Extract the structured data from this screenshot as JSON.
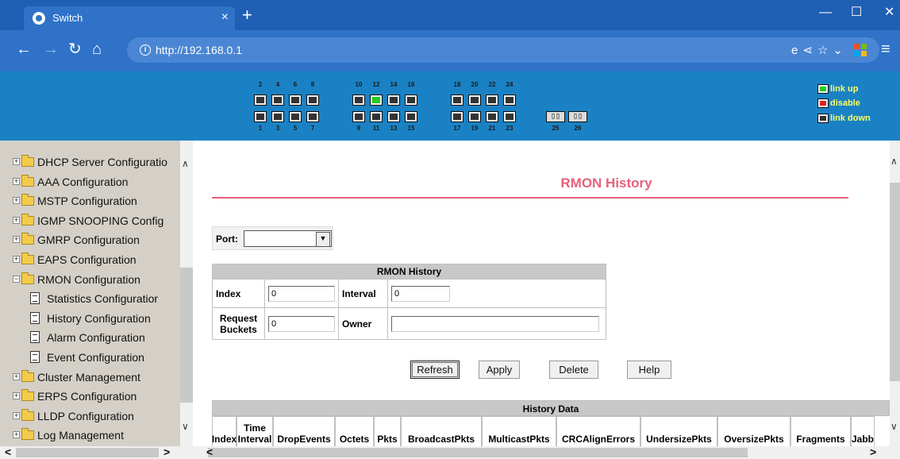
{
  "browser": {
    "tab_title": "Switch",
    "tab_close": "×",
    "new_tab": "+",
    "url": "http://192.168.0.1",
    "icons": [
      "browser-logo-icon",
      "back-icon",
      "forward-icon",
      "reload-icon",
      "home-icon",
      "info-icon",
      "ie-mode-icon",
      "share-icon",
      "star-icon",
      "chevron-down-icon",
      "apps-icon",
      "menu-icon",
      "minimize-icon",
      "maximize-icon",
      "close-icon"
    ]
  },
  "ports": {
    "top_numbers": [
      "2",
      "4",
      "6",
      "8",
      "10",
      "12",
      "14",
      "16",
      "18",
      "20",
      "22",
      "24"
    ],
    "bottom_numbers": [
      "1",
      "3",
      "5",
      "7",
      "9",
      "11",
      "13",
      "15",
      "17",
      "19",
      "21",
      "23"
    ],
    "fiber_numbers": [
      "25",
      "26"
    ],
    "link_up_port": "12",
    "legend": {
      "up": "link up",
      "disable": "disable",
      "down": "link down"
    },
    "colors": {
      "panel": "#1a82c4",
      "link_up": "#22cc22",
      "disable": "#dd2222",
      "legend_text": "#ffff66"
    }
  },
  "sidebar": {
    "items": [
      {
        "label": "DHCP Server Configuratio",
        "type": "folder",
        "expander": "+"
      },
      {
        "label": "AAA Configuration",
        "type": "folder",
        "expander": "+"
      },
      {
        "label": "MSTP Configuration",
        "type": "folder",
        "expander": "+"
      },
      {
        "label": "IGMP SNOOPING Config",
        "type": "folder",
        "expander": "+"
      },
      {
        "label": "GMRP Configuration",
        "type": "folder",
        "expander": "+"
      },
      {
        "label": "EAPS Configuration",
        "type": "folder",
        "expander": "+"
      },
      {
        "label": "RMON Configuration",
        "type": "folder-open",
        "expander": "−"
      },
      {
        "label": "Statistics Configuratior",
        "type": "doc"
      },
      {
        "label": "History Configuration",
        "type": "doc"
      },
      {
        "label": "Alarm Configuration",
        "type": "doc"
      },
      {
        "label": "Event Configuration",
        "type": "doc"
      },
      {
        "label": "Cluster Management",
        "type": "folder",
        "expander": "+"
      },
      {
        "label": "ERPS Configuration",
        "type": "folder",
        "expander": "+"
      },
      {
        "label": "LLDP Configuration",
        "type": "folder",
        "expander": "+"
      },
      {
        "label": "Log Management",
        "type": "folder",
        "expander": "+"
      }
    ]
  },
  "main": {
    "title": "RMON History",
    "title_color": "#e8607a",
    "port_label": "Port:",
    "port_value": "",
    "form": {
      "heading": "RMON History",
      "index_label": "Index",
      "index_value": "0",
      "interval_label": "Interval",
      "interval_value": "0",
      "buckets_label_1": "Request",
      "buckets_label_2": "Buckets",
      "buckets_value": "0",
      "owner_label": "Owner",
      "owner_value": ""
    },
    "buttons": {
      "refresh": "Refresh",
      "apply": "Apply",
      "delete": "Delete",
      "help": "Help"
    },
    "history": {
      "heading": "History Data",
      "columns": [
        "Index",
        "Time Interval",
        "DropEvents",
        "Octets",
        "Pkts",
        "BroadcastPkts",
        "MulticastPkts",
        "CRCAlignErrors",
        "UndersizePkts",
        "OversizePkts",
        "Fragments",
        "Jabb"
      ]
    }
  }
}
